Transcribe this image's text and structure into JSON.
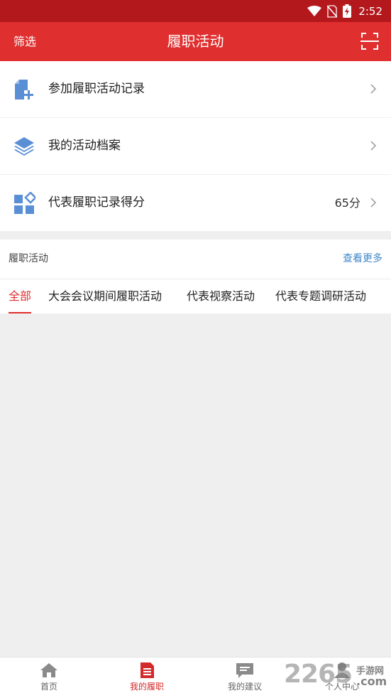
{
  "status_bar": {
    "time": "2:52"
  },
  "app_bar": {
    "left_label": "筛选",
    "title": "履职活动"
  },
  "menu": {
    "items": [
      {
        "label": "参加履职活动记录",
        "value": ""
      },
      {
        "label": "我的活动档案",
        "value": ""
      },
      {
        "label": "代表履职记录得分",
        "value": "65分"
      }
    ]
  },
  "activity_section": {
    "title": "履职活动",
    "more_label": "查看更多",
    "tabs": [
      {
        "label": "全部",
        "active": true
      },
      {
        "label": "大会会议期间履职活动",
        "active": false
      },
      {
        "label": "代表视察活动",
        "active": false
      },
      {
        "label": "代表专题调研活动",
        "active": false
      }
    ]
  },
  "bottom_nav": {
    "items": [
      {
        "label": "首页",
        "icon": "home-icon",
        "active": false
      },
      {
        "label": "我的履职",
        "icon": "document-icon",
        "active": true
      },
      {
        "label": "我的建议",
        "icon": "message-icon",
        "active": false
      },
      {
        "label": "个人中心",
        "icon": "person-icon",
        "active": false
      }
    ]
  },
  "watermark": {
    "number": "2265",
    "cn": "手游网",
    "suffix": ".com"
  },
  "colors": {
    "primary": "#e02f2f",
    "status_bar": "#b3181d",
    "link": "#3f86c8",
    "icon_blue": "#5a8fd6"
  }
}
